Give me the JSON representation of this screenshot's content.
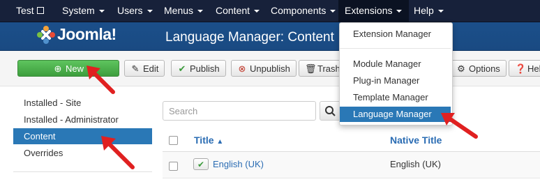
{
  "topnav": {
    "site": "Test",
    "items": [
      "System",
      "Users",
      "Menus",
      "Content",
      "Components",
      "Extensions",
      "Help"
    ]
  },
  "header": {
    "logo": "Joomla!",
    "title": "Language Manager: Content"
  },
  "toolbar": {
    "new": "New",
    "edit": "Edit",
    "publish": "Publish",
    "unpublish": "Unpublish",
    "trash": "Trash",
    "options": "Options",
    "help": "Help"
  },
  "sidebar": {
    "items": [
      "Installed - Site",
      "Installed - Administrator",
      "Content",
      "Overrides"
    ],
    "active_index": 2
  },
  "search": {
    "placeholder": "Search"
  },
  "table": {
    "columns": [
      "Title",
      "Native Title"
    ],
    "rows": [
      {
        "title": "English (UK)",
        "native": "English (UK)"
      }
    ]
  },
  "extensions_menu": {
    "items": [
      "Extension Manager",
      "Module Manager",
      "Plug-in Manager",
      "Template Manager",
      "Language Manager"
    ],
    "active_index": 4
  },
  "colors": {
    "navbar": "#17213a",
    "header": "#1b4f8a",
    "accent": "#2a78b6",
    "new_button": "#46a546",
    "annotation_arrow": "#e02020"
  },
  "icons": {
    "new": "plus-circle-icon",
    "edit": "edit-icon",
    "publish": "check-icon",
    "unpublish": "times-circle-icon",
    "trash": "trash-icon",
    "options": "gear-icon",
    "help": "question-circle-icon",
    "search": "search-icon",
    "sort": "sort-asc-icon",
    "external": "external-link-icon"
  }
}
